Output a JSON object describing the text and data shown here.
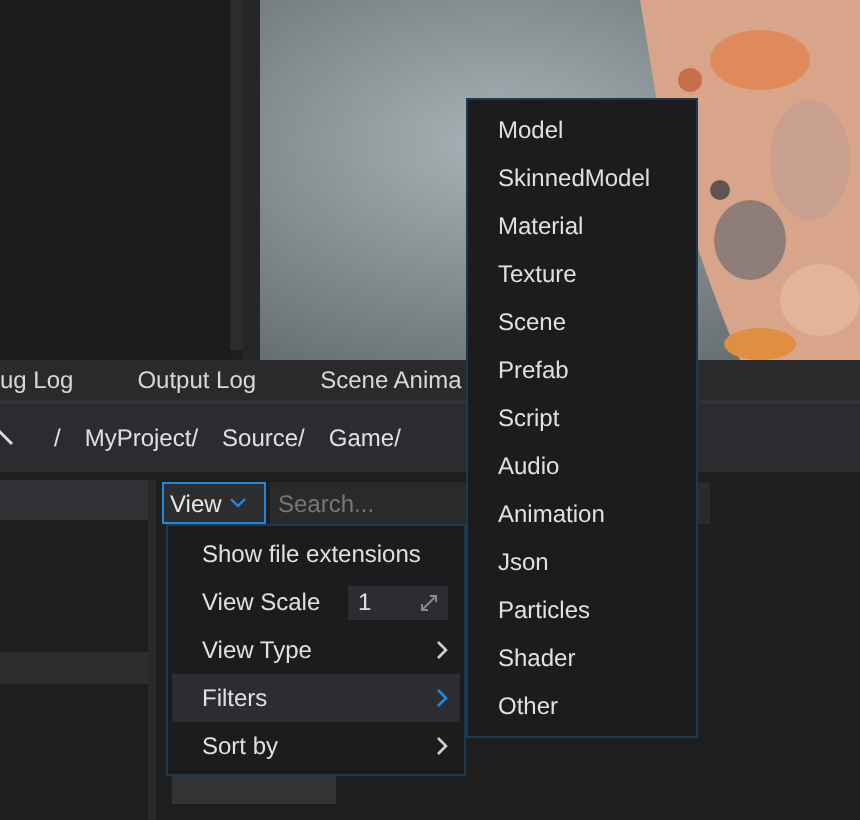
{
  "tabs": [
    {
      "label": "ug Log",
      "selected": false
    },
    {
      "label": "Output Log",
      "selected": false
    },
    {
      "label": "Scene Anima",
      "selected": false
    }
  ],
  "breadcrumb": {
    "separator": "/",
    "items": [
      "MyProject/",
      "Source/",
      "Game/"
    ]
  },
  "toolbar": {
    "view_button": {
      "label": "View"
    },
    "search": {
      "placeholder": "Search..."
    }
  },
  "view_menu": {
    "items": [
      {
        "kind": "action",
        "label": "Show file extensions",
        "selected": false
      },
      {
        "kind": "number",
        "label": "View Scale",
        "value": "1",
        "selected": false
      },
      {
        "kind": "submenu",
        "label": "View Type",
        "selected": false
      },
      {
        "kind": "submenu",
        "label": "Filters",
        "selected": true
      },
      {
        "kind": "submenu",
        "label": "Sort by",
        "selected": false
      }
    ]
  },
  "filters_menu": {
    "items": [
      {
        "label": "Model",
        "selected": false
      },
      {
        "label": "SkinnedModel",
        "selected": false
      },
      {
        "label": "Material",
        "selected": false
      },
      {
        "label": "Texture",
        "selected": false
      },
      {
        "label": "Scene",
        "selected": false
      },
      {
        "label": "Prefab",
        "selected": false
      },
      {
        "label": "Script",
        "selected": false
      },
      {
        "label": "Audio",
        "selected": false
      },
      {
        "label": "Animation",
        "selected": false
      },
      {
        "label": "Json",
        "selected": false
      },
      {
        "label": "Particles",
        "selected": false
      },
      {
        "label": "Shader",
        "selected": false
      },
      {
        "label": "Other",
        "selected": false
      }
    ]
  }
}
